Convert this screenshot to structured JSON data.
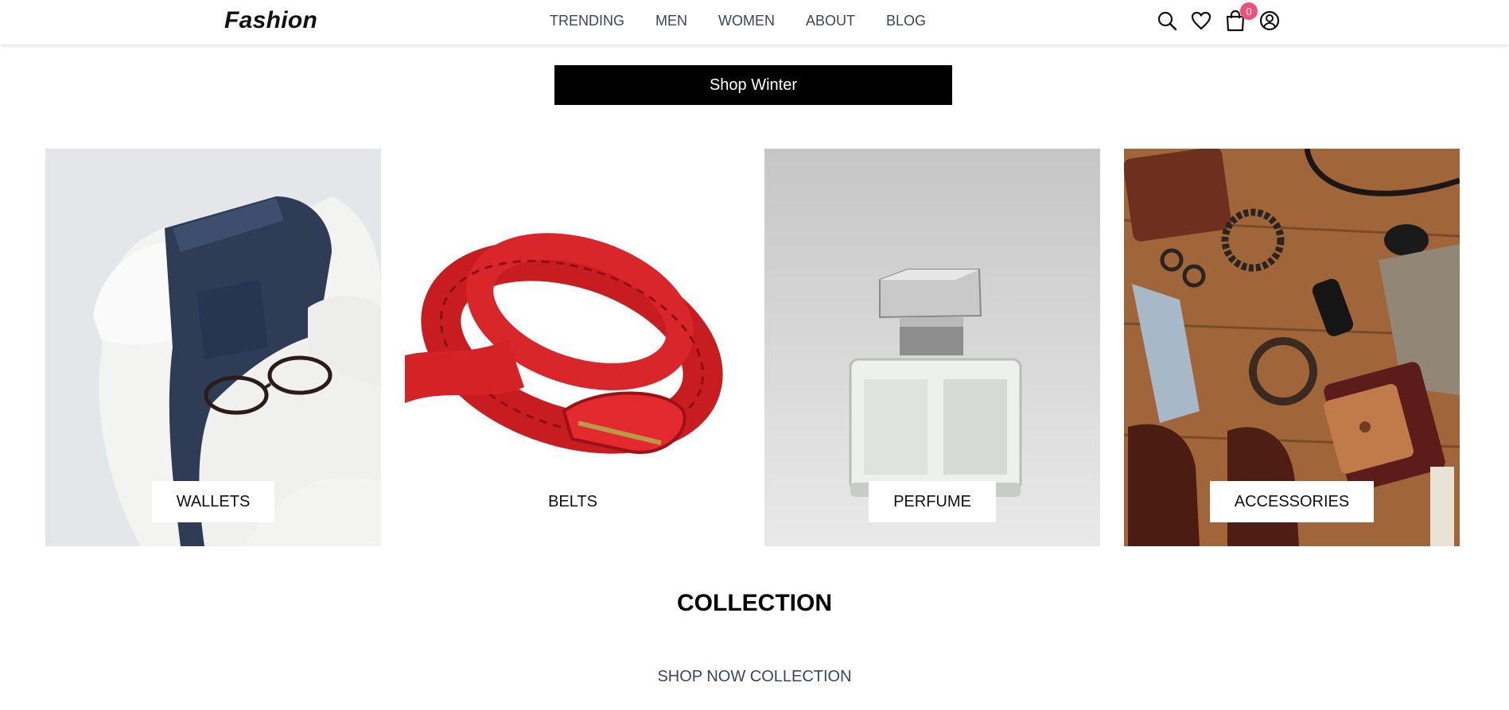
{
  "header": {
    "logo": "Fashion",
    "nav": [
      "TRENDING",
      "MEN",
      "WOMEN",
      "ABOUT",
      "BLOG"
    ],
    "icons": [
      "search-icon",
      "heart-icon",
      "cart-icon",
      "user-icon"
    ],
    "cart_count": "0",
    "badge_color": "#f0507a"
  },
  "hero": {
    "button_label": "Shop Winter"
  },
  "categories": [
    {
      "label": "WALLETS",
      "image": "folded jeans, white sweater and glasses"
    },
    {
      "label": "BELTS",
      "image": "red braided leather belt"
    },
    {
      "label": "PERFUME",
      "image": "glass perfume bottle"
    },
    {
      "label": "ACCESSORIES",
      "image": "leather wallets, bracelets, sunglasses on wood"
    }
  ],
  "collection": {
    "title": "COLLECTION",
    "subtitle": "SHOP NOW COLLECTION"
  }
}
